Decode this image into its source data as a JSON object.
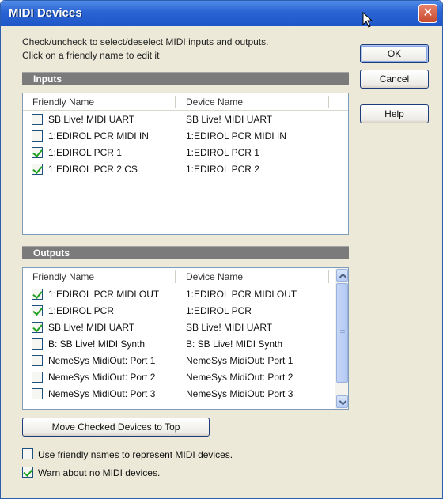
{
  "window": {
    "title": "MIDI Devices"
  },
  "instructions": {
    "line1": "Check/uncheck to select/deselect MIDI inputs and outputs.",
    "line2": "Click on a friendly name to edit it"
  },
  "buttons": {
    "ok": "OK",
    "cancel": "Cancel",
    "help": "Help",
    "move_checked": "Move Checked Devices to Top"
  },
  "inputs": {
    "header": "Inputs",
    "columns": {
      "friendly": "Friendly Name",
      "device": "Device Name"
    },
    "rows": [
      {
        "checked": false,
        "friendly": "SB Live! MIDI UART",
        "device": "SB Live! MIDI UART"
      },
      {
        "checked": false,
        "friendly": "1:EDIROL PCR MIDI IN",
        "device": "1:EDIROL PCR MIDI IN"
      },
      {
        "checked": true,
        "friendly": "1:EDIROL PCR 1",
        "device": "1:EDIROL PCR 1"
      },
      {
        "checked": true,
        "friendly": "1:EDIROL PCR 2 CS",
        "device": "1:EDIROL PCR 2"
      }
    ]
  },
  "outputs": {
    "header": "Outputs",
    "columns": {
      "friendly": "Friendly Name",
      "device": "Device Name"
    },
    "rows": [
      {
        "checked": true,
        "friendly": "1:EDIROL PCR MIDI OUT",
        "device": "1:EDIROL PCR MIDI OUT"
      },
      {
        "checked": true,
        "friendly": "1:EDIROL PCR",
        "device": "1:EDIROL PCR"
      },
      {
        "checked": true,
        "friendly": "SB Live! MIDI UART",
        "device": "SB Live! MIDI UART"
      },
      {
        "checked": false,
        "friendly": "B: SB Live! MIDI Synth",
        "device": "B: SB Live! MIDI Synth"
      },
      {
        "checked": false,
        "friendly": "NemeSys MidiOut: Port 1",
        "device": "NemeSys MidiOut: Port 1"
      },
      {
        "checked": false,
        "friendly": "NemeSys MidiOut: Port 2",
        "device": "NemeSys MidiOut: Port 2"
      },
      {
        "checked": false,
        "friendly": "NemeSys MidiOut: Port 3",
        "device": "NemeSys MidiOut: Port 3"
      }
    ]
  },
  "options": [
    {
      "checked": false,
      "label": "Use friendly names to represent MIDI devices."
    },
    {
      "checked": true,
      "label": "Warn about no MIDI devices."
    }
  ],
  "colors": {
    "titlebar": "#2a63d3",
    "section_header": "#7b7b7b",
    "checkmark": "#21a121"
  }
}
